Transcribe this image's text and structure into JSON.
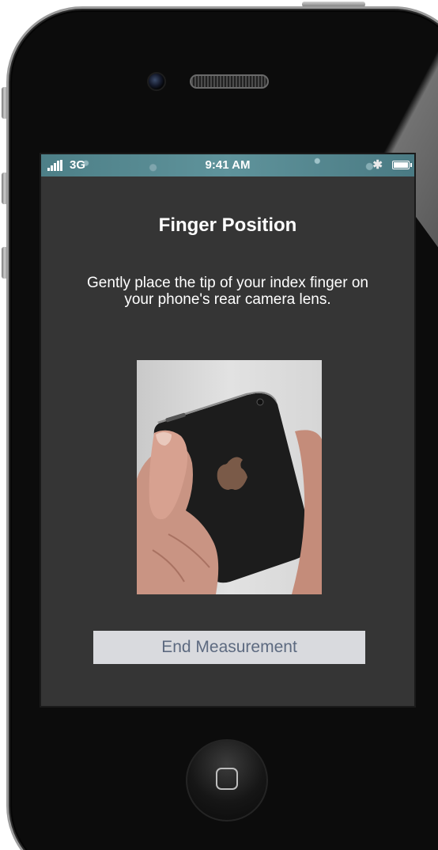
{
  "status_bar": {
    "network": "3G",
    "time": "9:41 AM",
    "signal_icon": "signal-bars-icon",
    "bluetooth_icon": "bluetooth-icon",
    "battery_icon": "battery-icon",
    "battery_level": 1.0
  },
  "screen": {
    "title": "Finger Position",
    "instructions": "Gently place the tip of your index finger on your phone's rear camera lens.",
    "illustration": "hand-holding-phone-image",
    "end_button_label": "End Measurement"
  },
  "device": {
    "home_button_icon": "home-square-icon"
  },
  "colors": {
    "screen_background": "#353535",
    "status_bar": "#5f939b",
    "button_background": "#d9dade",
    "button_text": "#5d6a80"
  }
}
